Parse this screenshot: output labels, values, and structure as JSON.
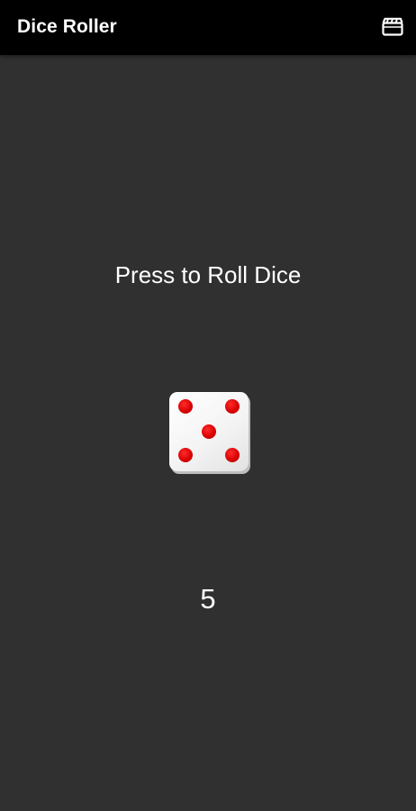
{
  "app_bar": {
    "title": "Dice Roller",
    "action_icon": "film-clapper-icon"
  },
  "main": {
    "prompt": "Press to Roll Dice",
    "dice": {
      "face_value": 5,
      "pip_color": "#d60000",
      "face_color": "#f4f4f4"
    },
    "result": "5"
  },
  "colors": {
    "background": "#303030",
    "app_bar": "#000000",
    "text": "#ffffff"
  }
}
